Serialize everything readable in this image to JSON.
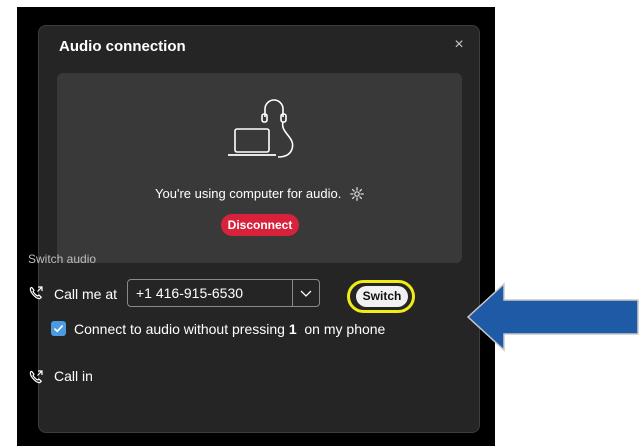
{
  "dialog": {
    "title": "Audio connection",
    "close_glyph": "×"
  },
  "status_panel": {
    "message": "You're using computer for audio.",
    "disconnect_label": "Disconnect",
    "icon": "headset-laptop-icon"
  },
  "switch_audio": {
    "section_label": "Switch audio",
    "call_me_label": "Call me at",
    "phone_number": "+1 416-915-6530",
    "switch_label": "Switch",
    "checkbox_checked": true,
    "checkbox_text_before": "Connect to audio without pressing ",
    "checkbox_text_bold": "1",
    "checkbox_text_after": "  on my phone",
    "call_in_label": "Call in"
  },
  "colors": {
    "dialog_bg": "#252525",
    "panel_bg": "#393939",
    "disconnect_red": "#d8223b",
    "checkbox_blue": "#4c9be0",
    "highlight_yellow": "#f2ec16",
    "arrow_blue": "#1f5aa6"
  }
}
